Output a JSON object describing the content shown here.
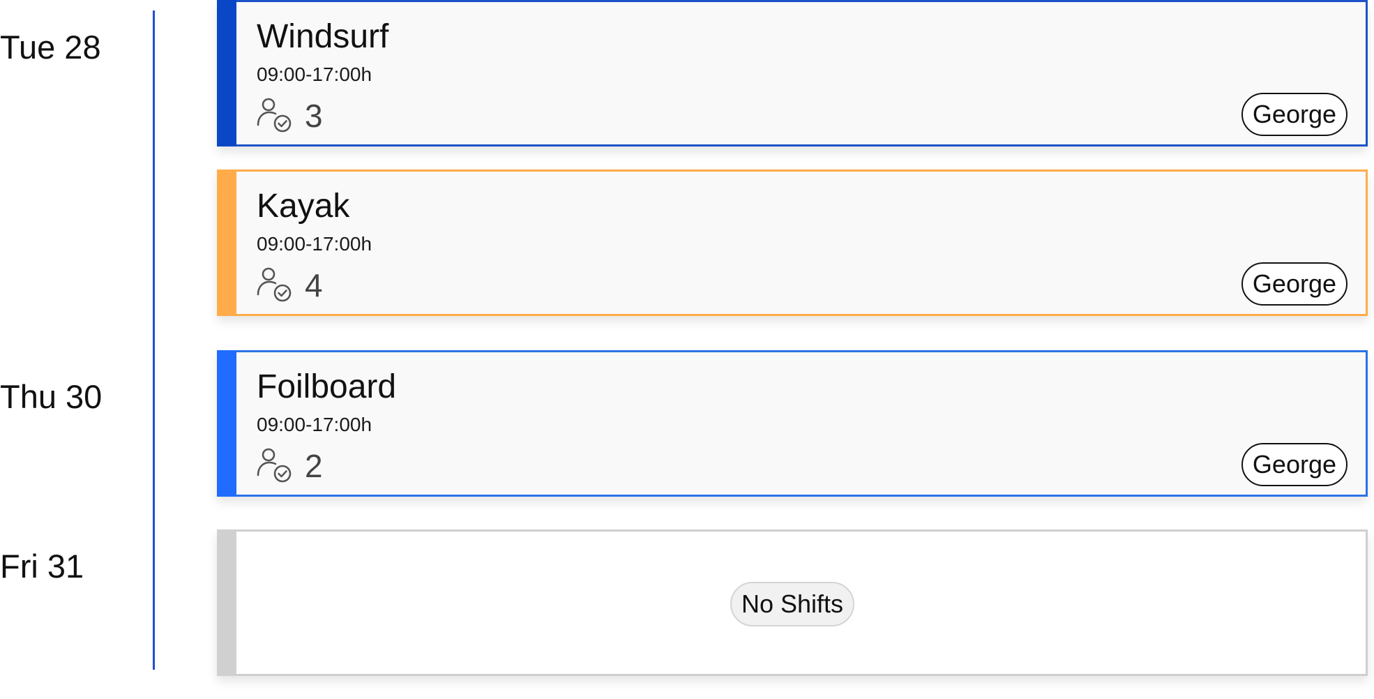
{
  "days": [
    {
      "label": "Tue 28"
    },
    {
      "label": "Thu 30"
    },
    {
      "label": "Fri 31"
    }
  ],
  "shifts": [
    {
      "title": "Windsurf",
      "time": "09:00-17:00h",
      "staff_count": "3",
      "assignee": "George",
      "accent_color": "#0a47c7",
      "border_color": "#1d52c9"
    },
    {
      "title": "Kayak",
      "time": "09:00-17:00h",
      "staff_count": "4",
      "assignee": "George",
      "accent_color": "#ffab4a",
      "border_color": "#ffab4a"
    },
    {
      "title": "Foilboard",
      "time": "09:00-17:00h",
      "staff_count": "2",
      "assignee": "George",
      "accent_color": "#1f6cff",
      "border_color": "#2c72e6"
    }
  ],
  "empty_day": {
    "message": "No Shifts",
    "accent_color": "#d0d0d0"
  },
  "icons": {
    "staff": "person-check-icon"
  },
  "colors": {
    "timeline": "#1f4fcf"
  }
}
